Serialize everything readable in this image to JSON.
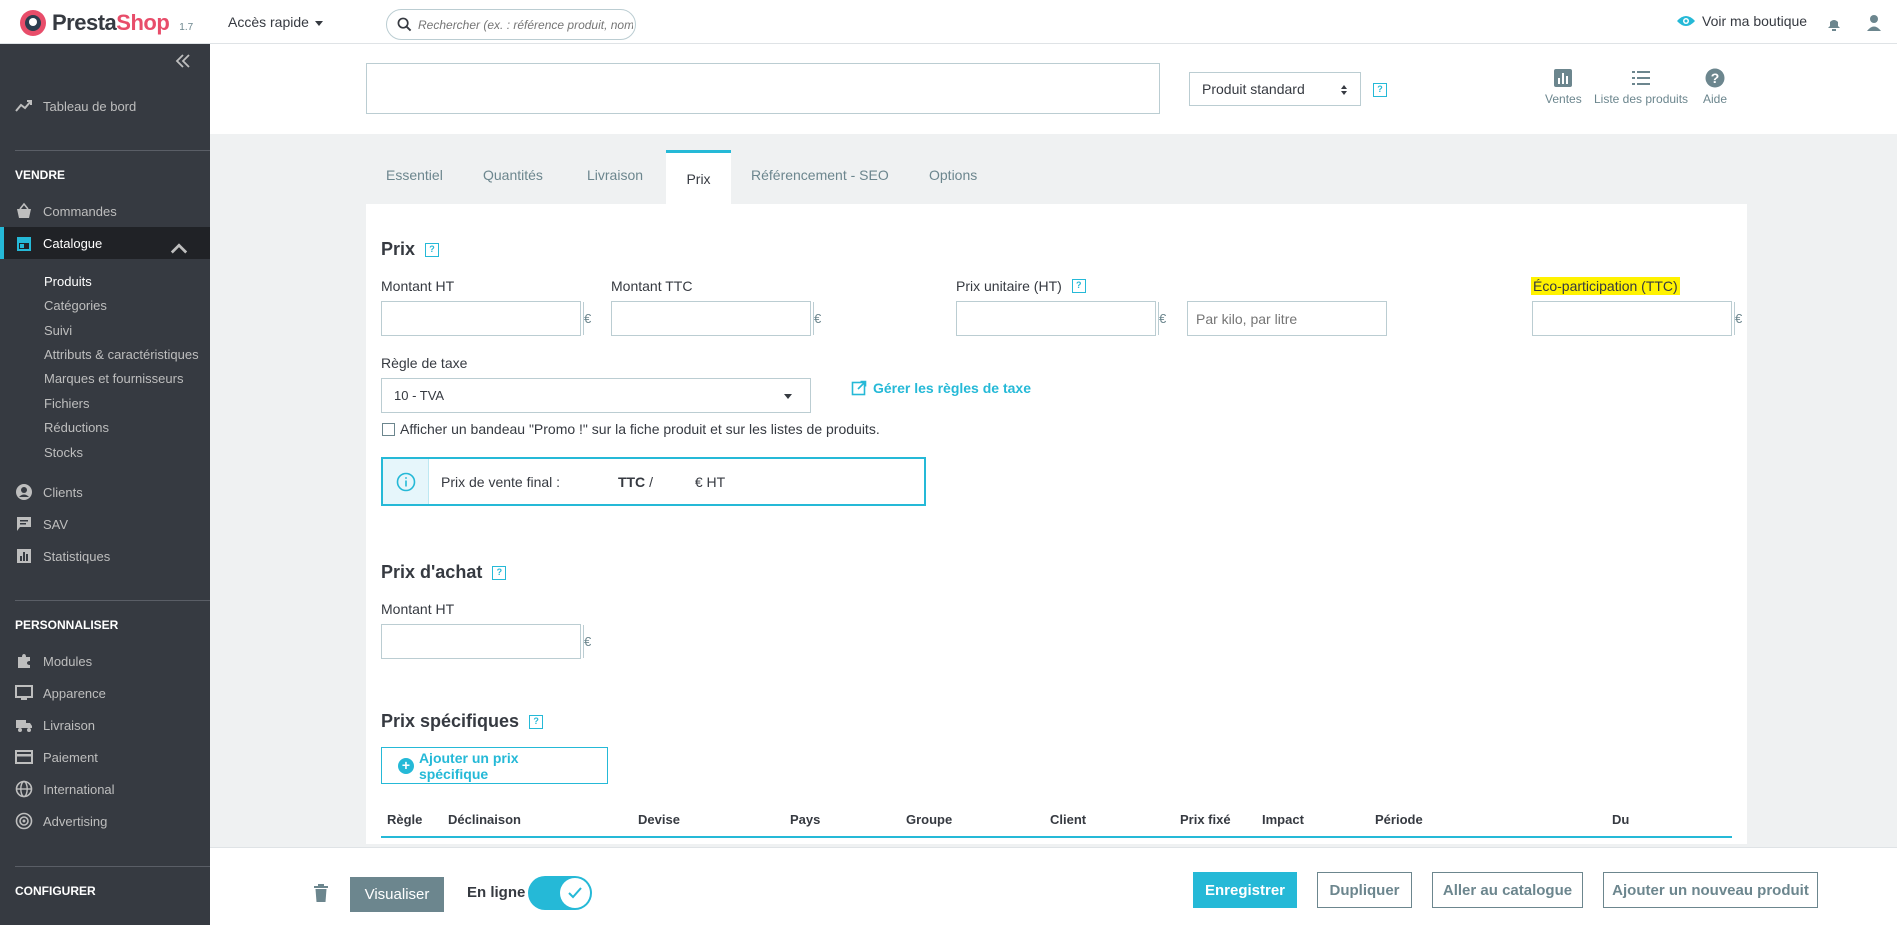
{
  "topbar": {
    "logo_pre": "Presta",
    "logo_shop": "Shop",
    "version": "1.7",
    "quick_access": "Accès rapide",
    "search_placeholder": "Rechercher (ex. : référence produit, nom",
    "view_shop": "Voir ma boutique"
  },
  "sidebar": {
    "dashboard": "Tableau de bord",
    "section_sell": "VENDRE",
    "orders": "Commandes",
    "catalog": "Catalogue",
    "catalog_sub": [
      "Produits",
      "Catégories",
      "Suivi",
      "Attributs & caractéristiques",
      "Marques et fournisseurs",
      "Fichiers",
      "Réductions",
      "Stocks"
    ],
    "customers": "Clients",
    "sav": "SAV",
    "stats": "Statistiques",
    "section_customize": "PERSONNALISER",
    "modules": "Modules",
    "appearance": "Apparence",
    "shipping": "Livraison",
    "payment": "Paiement",
    "international": "International",
    "advertising": "Advertising",
    "section_configure": "CONFIGURER"
  },
  "header": {
    "product_type": "Produit standard",
    "help_icon": "?",
    "actions": [
      "Ventes",
      "Liste des produits",
      "Aide"
    ]
  },
  "tabs": [
    "Essentiel",
    "Quantités",
    "Livraison",
    "Prix",
    "Référencement - SEO",
    "Options"
  ],
  "active_tab": "Prix",
  "prix": {
    "title": "Prix",
    "montant_ht": "Montant HT",
    "montant_ttc": "Montant TTC",
    "prix_unitaire": "Prix unitaire (HT)",
    "unit_placeholder": "Par kilo, par litre",
    "eco": "Éco-participation (TTC)",
    "currency": "€",
    "tax_rule_label": "Règle de taxe",
    "tax_rule_value": "10 - TVA",
    "manage_tax": "Gérer les règles de taxe",
    "promo_checkbox": "Afficher un bandeau \"Promo !\" sur la fiche produit et sur les listes de produits.",
    "final_price_prefix": "Prix de vente final :",
    "final_ttc": "TTC",
    "final_sep": "/",
    "final_ht": "€ HT"
  },
  "achat": {
    "title": "Prix d'achat",
    "montant_ht": "Montant HT",
    "currency": "€"
  },
  "specifiques": {
    "title": "Prix spécifiques",
    "add_button": "Ajouter un prix spécifique",
    "columns": [
      "Règle",
      "Déclinaison",
      "Devise",
      "Pays",
      "Groupe",
      "Client",
      "Prix fixé",
      "Impact",
      "Période",
      "Du"
    ]
  },
  "footer": {
    "preview": "Visualiser",
    "online": "En ligne",
    "online_state": true,
    "save": "Enregistrer",
    "duplicate": "Dupliquer",
    "go_catalog": "Aller au catalogue",
    "add_new": "Ajouter un nouveau produit"
  },
  "colors": {
    "accent": "#25b9d7",
    "sidebar": "#363a41",
    "brand_pink": "#e84d6a",
    "highlight": "#fff200"
  }
}
